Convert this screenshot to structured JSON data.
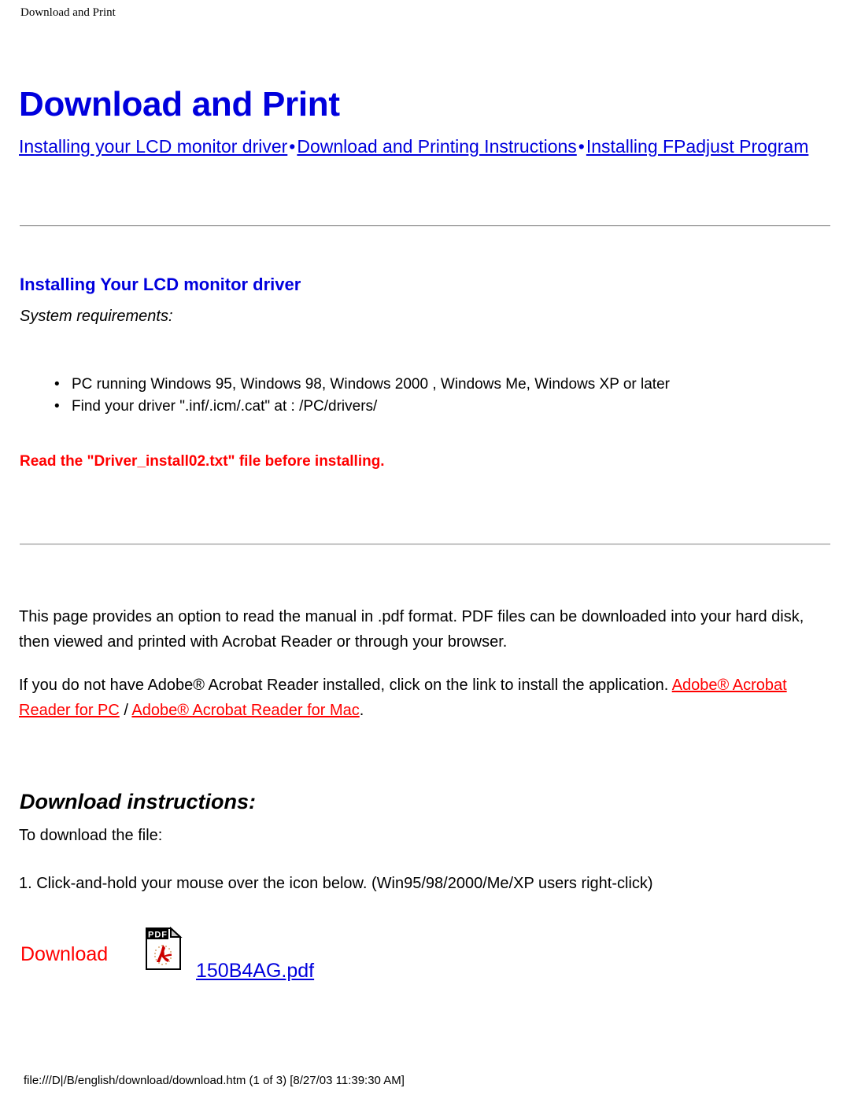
{
  "document": {
    "running_header": "Download and Print",
    "title": "Download and Print"
  },
  "nav": {
    "separator": "•",
    "links": [
      {
        "label": "Installing your LCD monitor driver"
      },
      {
        "label": "Download and Printing Instructions"
      },
      {
        "label": "Installing FPadjust Program"
      }
    ]
  },
  "driver_section": {
    "heading": "Installing Your LCD monitor driver",
    "system_requirements_label": "System requirements:",
    "bullets": [
      {
        "marker": "•",
        "text": "PC running Windows 95, Windows 98, Windows 2000 , Windows Me, Windows XP or later",
        "wrapped": true
      },
      {
        "marker": "•",
        "text": "Find your driver \".inf/.icm/.cat\" at : /PC/drivers/",
        "wrapped": false
      }
    ],
    "warning": "Read the \"Driver_install02.txt\" file before installing."
  },
  "pdf_section": {
    "paragraph_1": "This page provides an option to read the manual in .pdf format. PDF files can be downloaded into your hard disk, then viewed and printed with Acrobat Reader or through your browser.",
    "paragraph_2_before": "If you do not have Adobe® Acrobat Reader installed, click on the link to install the application. ",
    "link_pc": "Adobe® Acrobat Reader for PC",
    "paragraph_2_middle": " / ",
    "link_mac": "Adobe® Acrobat Reader for Mac",
    "paragraph_2_after": "."
  },
  "download_section": {
    "heading": "Download instructions:",
    "intro": "To download the file:",
    "step_1": "1. Click-and-hold your mouse over the icon below. (Win95/98/2000/Me/XP users right-click)",
    "download_label": "Download",
    "icon_label": "PDF",
    "file_link": "150B4AG.pdf"
  },
  "footer": {
    "text": "file:///D|/B/english/download/download.htm (1 of 3) [8/27/03 11:39:30 AM]"
  },
  "colors": {
    "link_blue": "#0000dd",
    "link_red": "#ff0000",
    "heading_blue": "#0000dd",
    "warning_red": "#ff0000",
    "text_black": "#000000"
  }
}
